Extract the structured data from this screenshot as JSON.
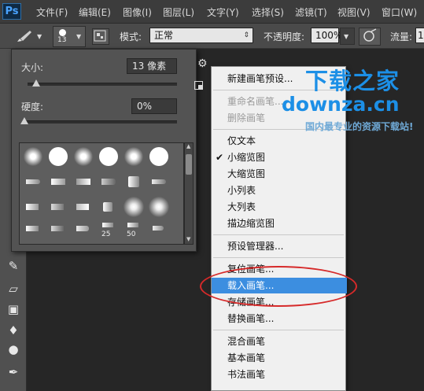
{
  "app": {
    "logo_text": "Ps"
  },
  "menubar": {
    "items": [
      "文件(F)",
      "编辑(E)",
      "图像(I)",
      "图层(L)",
      "文字(Y)",
      "选择(S)",
      "滤镜(T)",
      "视图(V)",
      "窗口(W)"
    ]
  },
  "options_bar": {
    "brush_size": "13",
    "mode_label": "模式:",
    "mode_value": "正常",
    "opacity_label": "不透明度:",
    "opacity_value": "100%",
    "flow_label": "流量:",
    "flow_value": "1"
  },
  "brush_picker": {
    "size_label": "大小:",
    "size_value": "13 像素",
    "size_slider_fraction": 0.06,
    "hardness_label": "硬度:",
    "hardness_value": "0%",
    "hardness_slider_fraction": 0.0,
    "preset_numbers": [
      "25",
      "50"
    ],
    "icons": [
      "gear-icon",
      "new-preset-icon"
    ]
  },
  "context_menu": {
    "items": [
      {
        "label": "新建画笔预设...",
        "state": "normal"
      },
      {
        "type": "separator"
      },
      {
        "label": "重命名画笔...",
        "state": "disabled"
      },
      {
        "label": "删除画笔",
        "state": "disabled"
      },
      {
        "type": "separator"
      },
      {
        "label": "仅文本",
        "state": "normal"
      },
      {
        "label": "小缩览图",
        "state": "checked"
      },
      {
        "label": "大缩览图",
        "state": "normal"
      },
      {
        "label": "小列表",
        "state": "normal"
      },
      {
        "label": "大列表",
        "state": "normal"
      },
      {
        "label": "描边缩览图",
        "state": "normal"
      },
      {
        "type": "separator"
      },
      {
        "label": "预设管理器...",
        "state": "normal"
      },
      {
        "type": "separator"
      },
      {
        "label": "复位画笔...",
        "state": "normal"
      },
      {
        "label": "载入画笔...",
        "state": "highlighted"
      },
      {
        "label": "存储画笔...",
        "state": "normal"
      },
      {
        "label": "替换画笔...",
        "state": "normal"
      },
      {
        "type": "separator"
      },
      {
        "label": "混合画笔",
        "state": "normal"
      },
      {
        "label": "基本画笔",
        "state": "normal"
      },
      {
        "label": "书法画笔",
        "state": "normal"
      }
    ],
    "check_glyph": "✔"
  },
  "watermark": {
    "title": "下载之家",
    "domain": "downza.cn",
    "slogan": "国内最专业的资源下载站!"
  },
  "colors": {
    "highlight": "#3c8ee0",
    "annotation": "#d62a2a",
    "watermark": "#1c8fe6"
  }
}
